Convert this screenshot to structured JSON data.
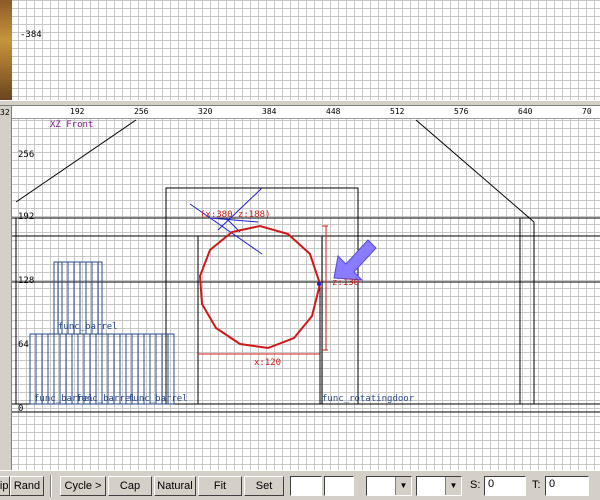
{
  "top_view": {
    "y_tick": "-384"
  },
  "front_view": {
    "label": "XZ Front",
    "x_ticks": [
      "192",
      "256",
      "320",
      "384",
      "448",
      "512",
      "576",
      "640",
      "70"
    ],
    "y_ticks": [
      "256",
      "192",
      "128",
      "64",
      "0"
    ],
    "left_edge_tick": "32",
    "entities": {
      "barrel_label_1": "func_barrel",
      "barrel_label_2": "func_barrel",
      "barrel_label_3": "func_barrel",
      "barrel_label_4": "func_barrel",
      "door_label": "func_rotatingdoor"
    },
    "annotations": {
      "coord": "(x:380  z:188)",
      "z_size": "z:130",
      "x_size": "x:120"
    },
    "colors": {
      "selection": "#d01818",
      "gizmo": "#2020d0",
      "barrel": "#2a4a8a",
      "brush": "#000000",
      "arrow": "#8a7cff"
    }
  },
  "toolbar": {
    "clip": "lip",
    "rand": "Rand",
    "cycle": "Cycle >",
    "cap": "Cap",
    "natural": "Natural",
    "fit": "Fit",
    "set": "Set",
    "field1": "",
    "field2": "",
    "combo1": "",
    "combo2": "",
    "s_label": "S:",
    "s_value": "0",
    "t_label": "T:",
    "t_value": "0"
  }
}
